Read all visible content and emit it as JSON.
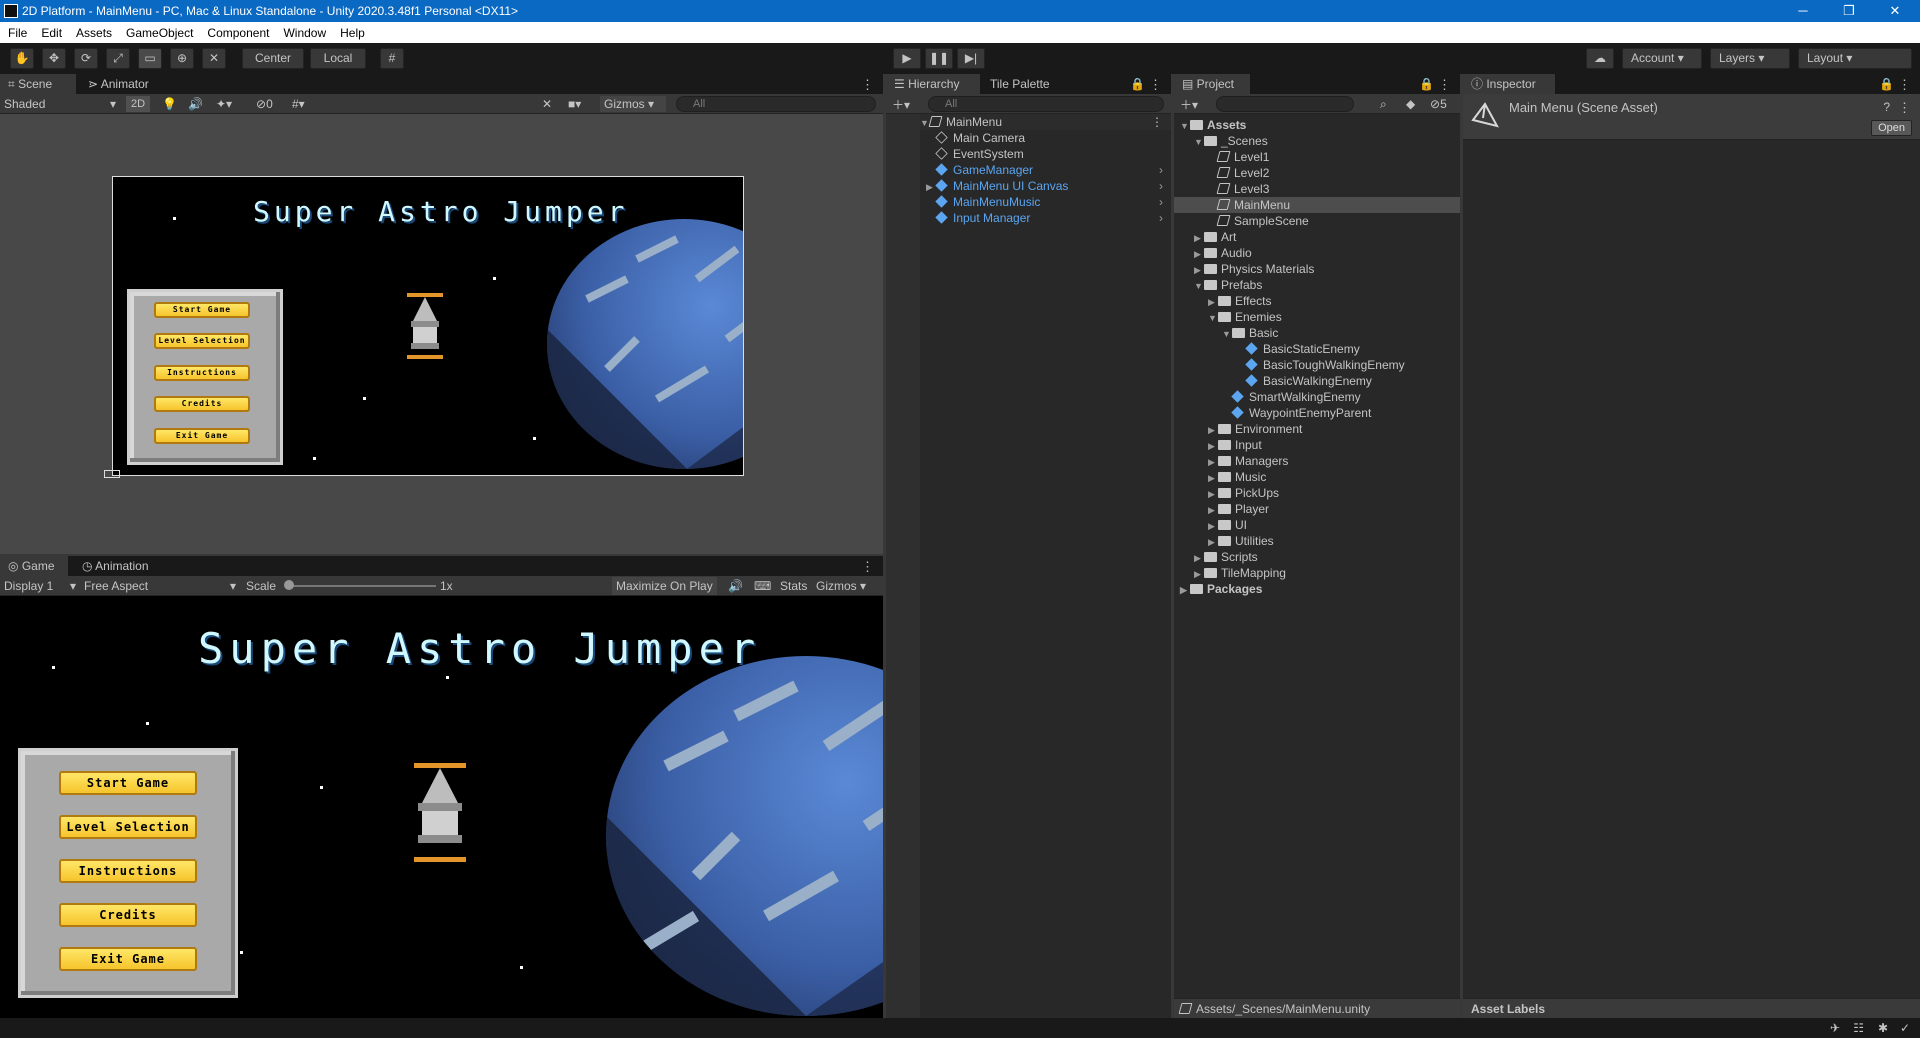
{
  "window": {
    "title": "2D Platform - MainMenu - PC, Mac & Linux Standalone - Unity 2020.3.48f1 Personal <DX11>",
    "min": "─",
    "max": "❐",
    "close": "✕"
  },
  "menu": [
    "File",
    "Edit",
    "Assets",
    "GameObject",
    "Component",
    "Window",
    "Help"
  ],
  "toolbar": {
    "center": "Center",
    "local": "Local",
    "account": "Account",
    "layers": "Layers",
    "layout": "Layout"
  },
  "scene": {
    "tabs": [
      "Scene",
      "Animator"
    ],
    "shading": "Shaded",
    "mode2d": "2D",
    "hidden_count": "0",
    "gizmos": "Gizmos",
    "search_placeholder": "All"
  },
  "game": {
    "tabs": [
      "Game",
      "Animation"
    ],
    "display": "Display 1",
    "aspect": "Free Aspect",
    "scale_label": "Scale",
    "scale_value": "1x",
    "maximize": "Maximize On Play",
    "stats": "Stats",
    "gizmos": "Gizmos"
  },
  "game_ui": {
    "title": "Super Astro Jumper",
    "buttons": [
      "Start Game",
      "Level Selection",
      "Instructions",
      "Credits",
      "Exit Game"
    ]
  },
  "hierarchy": {
    "tabs": [
      "Hierarchy",
      "Tile Palette"
    ],
    "search_placeholder": "All",
    "root": "MainMenu",
    "items": [
      {
        "label": "Main Camera",
        "prefab": false,
        "expand": false
      },
      {
        "label": "EventSystem",
        "prefab": false,
        "expand": false
      },
      {
        "label": "GameManager",
        "prefab": true,
        "expand": false
      },
      {
        "label": "MainMenu UI Canvas",
        "prefab": true,
        "expand": true
      },
      {
        "label": "MainMenuMusic",
        "prefab": true,
        "expand": false
      },
      {
        "label": "Input Manager",
        "prefab": true,
        "expand": false
      }
    ]
  },
  "project": {
    "tab": "Project",
    "hidden_count": "5",
    "tree": [
      {
        "label": "Assets",
        "depth": 0,
        "icon": "folder",
        "arrow": "▼",
        "bold": true
      },
      {
        "label": "_Scenes",
        "depth": 1,
        "icon": "folder-open",
        "arrow": "▼"
      },
      {
        "label": "Level1",
        "depth": 2,
        "icon": "scene",
        "arrow": ""
      },
      {
        "label": "Level2",
        "depth": 2,
        "icon": "scene",
        "arrow": ""
      },
      {
        "label": "Level3",
        "depth": 2,
        "icon": "scene",
        "arrow": ""
      },
      {
        "label": "MainMenu",
        "depth": 2,
        "icon": "scene",
        "arrow": "",
        "selected": true
      },
      {
        "label": "SampleScene",
        "depth": 2,
        "icon": "scene",
        "arrow": ""
      },
      {
        "label": "Art",
        "depth": 1,
        "icon": "folder",
        "arrow": "▶"
      },
      {
        "label": "Audio",
        "depth": 1,
        "icon": "folder",
        "arrow": "▶"
      },
      {
        "label": "Physics Materials",
        "depth": 1,
        "icon": "folder",
        "arrow": "▶"
      },
      {
        "label": "Prefabs",
        "depth": 1,
        "icon": "folder-open",
        "arrow": "▼"
      },
      {
        "label": "Effects",
        "depth": 2,
        "icon": "folder",
        "arrow": "▶"
      },
      {
        "label": "Enemies",
        "depth": 2,
        "icon": "folder-open",
        "arrow": "▼"
      },
      {
        "label": "Basic",
        "depth": 3,
        "icon": "folder-open",
        "arrow": "▼"
      },
      {
        "label": "BasicStaticEnemy",
        "depth": 4,
        "icon": "prefab",
        "arrow": ""
      },
      {
        "label": "BasicToughWalkingEnemy",
        "depth": 4,
        "icon": "prefab",
        "arrow": ""
      },
      {
        "label": "BasicWalkingEnemy",
        "depth": 4,
        "icon": "prefab",
        "arrow": ""
      },
      {
        "label": "SmartWalkingEnemy",
        "depth": 3,
        "icon": "prefab",
        "arrow": ""
      },
      {
        "label": "WaypointEnemyParent",
        "depth": 3,
        "icon": "prefab",
        "arrow": ""
      },
      {
        "label": "Environment",
        "depth": 2,
        "icon": "folder",
        "arrow": "▶"
      },
      {
        "label": "Input",
        "depth": 2,
        "icon": "folder",
        "arrow": "▶"
      },
      {
        "label": "Managers",
        "depth": 2,
        "icon": "folder",
        "arrow": "▶"
      },
      {
        "label": "Music",
        "depth": 2,
        "icon": "folder",
        "arrow": "▶"
      },
      {
        "label": "PickUps",
        "depth": 2,
        "icon": "folder",
        "arrow": "▶"
      },
      {
        "label": "Player",
        "depth": 2,
        "icon": "folder",
        "arrow": "▶"
      },
      {
        "label": "UI",
        "depth": 2,
        "icon": "folder",
        "arrow": "▶"
      },
      {
        "label": "Utilities",
        "depth": 2,
        "icon": "folder",
        "arrow": "▶"
      },
      {
        "label": "Scripts",
        "depth": 1,
        "icon": "folder",
        "arrow": "▶"
      },
      {
        "label": "TileMapping",
        "depth": 1,
        "icon": "folder",
        "arrow": "▶"
      },
      {
        "label": "Packages",
        "depth": 0,
        "icon": "folder",
        "arrow": "▶",
        "bold": true
      }
    ],
    "path": "Assets/_Scenes/MainMenu.unity"
  },
  "inspector": {
    "tab": "Inspector",
    "asset_title": "Main Menu (Scene Asset)",
    "open": "Open",
    "asset_labels": "Asset Labels"
  },
  "colors": {
    "accent_blue": "#0a69c3",
    "prefab_blue": "#5ba5f1",
    "button_yellow": "#f6c42d"
  }
}
